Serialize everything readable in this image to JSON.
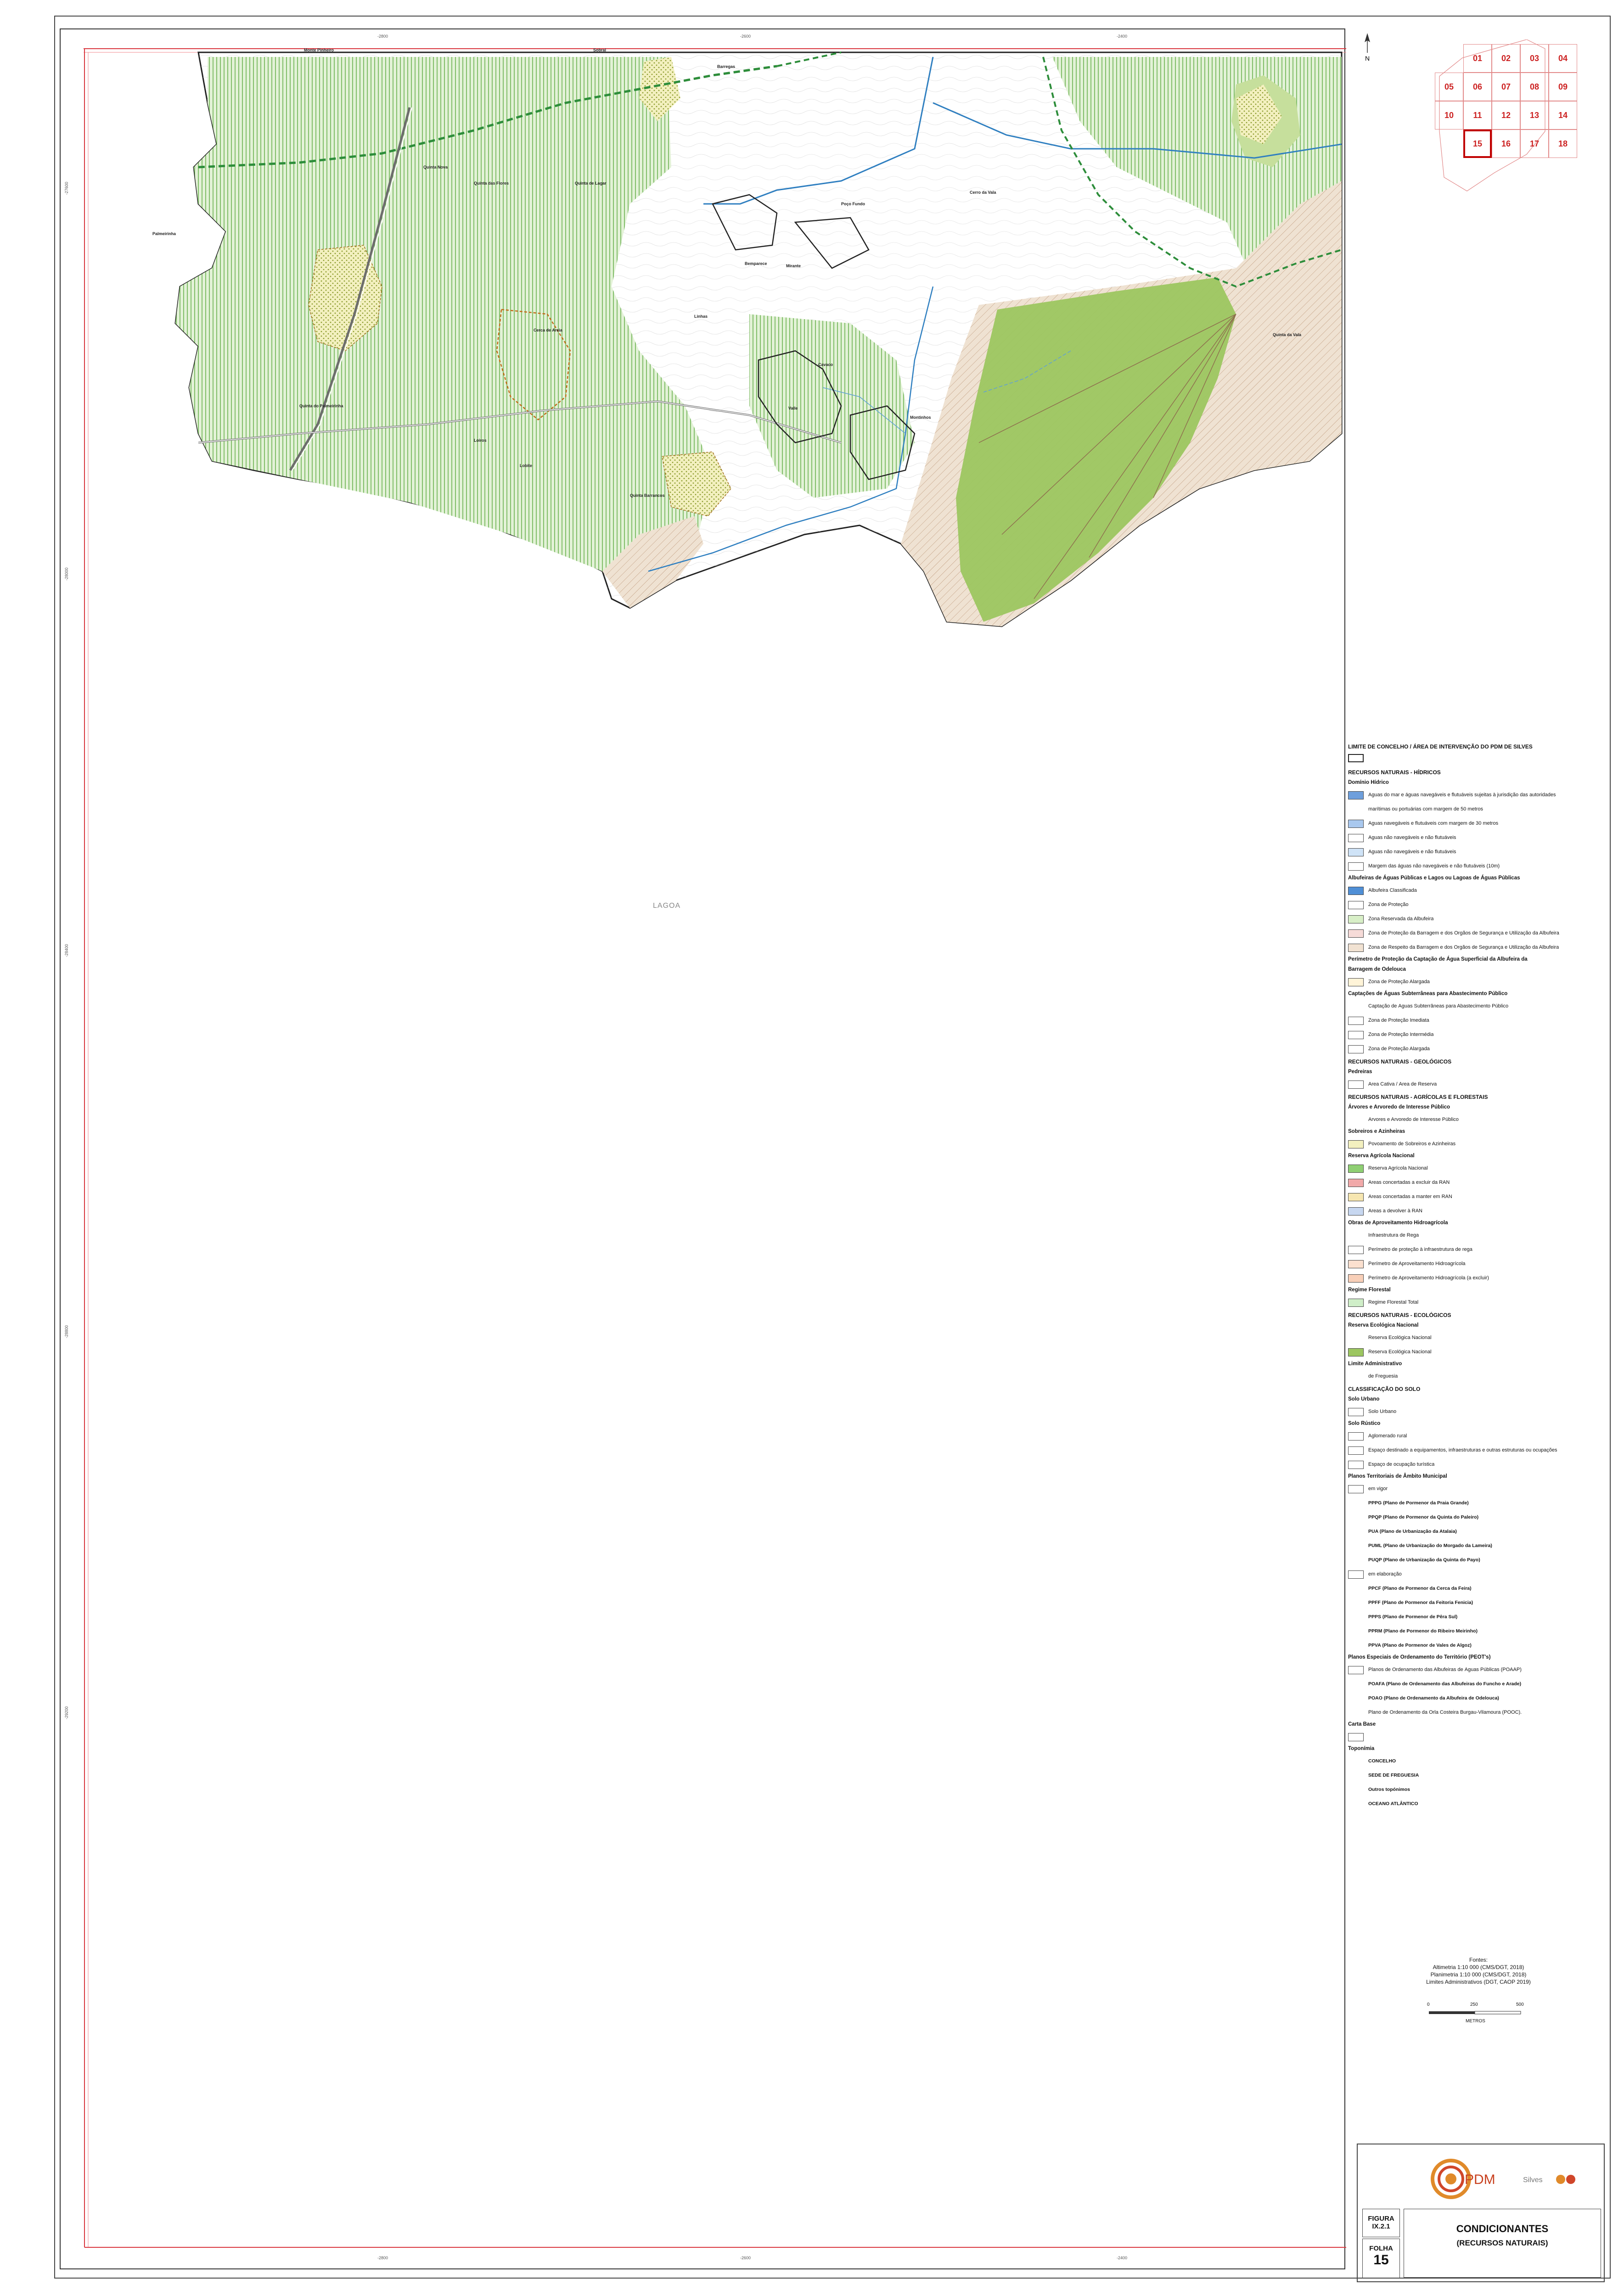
{
  "colors": {
    "ran_green": "#67b04c",
    "ren_green": "#9cc660",
    "river_blue": "#2f7fc0",
    "limit_red": "#d9363e",
    "boundary_dark": "#222222",
    "dashed_green": "#2d8d3a",
    "brown_hatch": "#9f6f55"
  },
  "map": {
    "concelho_label": "LAGOA",
    "coords_top": [
      "-2800",
      "-2600",
      "-2400"
    ],
    "coords_bottom": [
      "-2800",
      "-2600",
      "-2400"
    ],
    "coords_side": [
      "-27600",
      "-28000",
      "-28400",
      "-28800",
      "-29200"
    ],
    "toponyms": [
      {
        "text": "Monte Pinheiro"
      },
      {
        "text": "Sobral"
      },
      {
        "text": "Barregas"
      },
      {
        "text": "Quinta Nova"
      },
      {
        "text": "Quinta das Flores"
      },
      {
        "text": "Quinta de Lagar"
      },
      {
        "text": "Poço Fundo"
      },
      {
        "text": "Cerro da Vala"
      },
      {
        "text": "Palmeirinha"
      },
      {
        "text": "Bemparece"
      },
      {
        "text": "Mirante"
      },
      {
        "text": "Linhas"
      },
      {
        "text": "Cerca de Areia"
      },
      {
        "text": "Quinta do Palmeirinha"
      },
      {
        "text": "Cavaco"
      },
      {
        "text": "Valle"
      },
      {
        "text": "Montinhos"
      },
      {
        "text": "Loiros"
      },
      {
        "text": "Lobite"
      },
      {
        "text": "Quinta Barrancos"
      },
      {
        "text": "Quinta da Vala"
      }
    ]
  },
  "index_map": {
    "cells": [
      {
        "label": "01"
      },
      {
        "label": "02"
      },
      {
        "label": "03"
      },
      {
        "label": "04"
      },
      {
        "label": "05"
      },
      {
        "label": "06"
      },
      {
        "label": "07"
      },
      {
        "label": "08"
      },
      {
        "label": "09"
      },
      {
        "label": "10"
      },
      {
        "label": "11"
      },
      {
        "label": "12"
      },
      {
        "label": "13"
      },
      {
        "label": "14"
      },
      {
        "label": "15"
      },
      {
        "label": "16"
      },
      {
        "label": "17"
      },
      {
        "label": "18"
      }
    ],
    "current": "15",
    "north_label": "N"
  },
  "legend": {
    "limit_title": "LIMITE DE CONCELHO / ÁREA DE INTERVENÇÃO DO PDM DE SILVES",
    "rows": [
      {
        "kind": "h1",
        "text": "RECURSOS NATURAIS - HÍDRICOS"
      },
      {
        "kind": "h2",
        "text": "Domínio Hídrico"
      },
      {
        "kind": "item",
        "swatch": "#6e9fdc",
        "text": "Águas do mar e águas navegáveis e flutuáveis sujeitas à jurisdição das autoridades"
      },
      {
        "kind": "item",
        "swatch": "none",
        "text": "marítimas ou portuárias com margem de 50 metros"
      },
      {
        "kind": "item",
        "swatch": "#a9c8ee",
        "text": "Águas navegáveis e flutuáveis com margem de 30 metros"
      },
      {
        "kind": "item",
        "swatch": "#ffffff",
        "text": "Águas não navegáveis e não flutuáveis"
      },
      {
        "kind": "item",
        "swatch": "#cfe3f7",
        "text": "Águas não navegáveis e não flutuáveis"
      },
      {
        "kind": "item",
        "swatch": "#ffffff",
        "text": "Margem das águas não navegáveis e não flutuáveis (10m)"
      },
      {
        "kind": "h2",
        "text": "Albufeiras de Águas Públicas e Lagos ou Lagoas de Águas Públicas"
      },
      {
        "kind": "item",
        "swatch": "#4f8fd6",
        "text": "Albufeira Classificada"
      },
      {
        "kind": "item",
        "swatch": "#ffffff",
        "text": "Zona de Proteção"
      },
      {
        "kind": "item",
        "swatch": "#d8efc7",
        "text": "Zona Reservada da Albufeira"
      },
      {
        "kind": "item",
        "swatch": "#f6dbd8",
        "text": "Zona de Proteção da Barragem e dos Órgãos de Segurança e Utilização da Albufeira"
      },
      {
        "kind": "item",
        "swatch": "#f1e2d2",
        "text": "Zona de Respeito da Barragem e dos Órgãos de Segurança e Utilização da Albufeira"
      },
      {
        "kind": "h2",
        "text": "Perímetro de Proteção da Captação de Água Superficial da Albufeira da"
      },
      {
        "kind": "h2",
        "text": "Barragem de Odelouca"
      },
      {
        "kind": "item",
        "swatch": "#fff4d8",
        "text": "Zona de Proteção Alargada"
      },
      {
        "kind": "h2",
        "text": "Captações de Águas Subterrâneas para Abastecimento Público"
      },
      {
        "kind": "item",
        "swatch": "none",
        "text": "Captação de Águas Subterrâneas para Abastecimento Público"
      },
      {
        "kind": "item",
        "swatch": "#ffffff",
        "text": "Zona de Proteção Imediata"
      },
      {
        "kind": "item",
        "swatch": "#ffffff",
        "text": "Zona de Proteção Intermédia"
      },
      {
        "kind": "item",
        "swatch": "#ffffff",
        "text": "Zona de Proteção Alargada"
      },
      {
        "kind": "h1",
        "text": "RECURSOS NATURAIS - GEOLÓGICOS"
      },
      {
        "kind": "h2",
        "text": "Pedreiras"
      },
      {
        "kind": "item",
        "swatch": "#ffffff",
        "text": "Área Cativa / Área de Reserva"
      },
      {
        "kind": "h1",
        "text": "RECURSOS NATURAIS - AGRÍCOLAS E FLORESTAIS"
      },
      {
        "kind": "h2",
        "text": "Árvores e Arvoredo de Interesse Público"
      },
      {
        "kind": "item",
        "swatch": "none",
        "text": "Árvores e Arvoredo de Interesse Público"
      },
      {
        "kind": "h2",
        "text": "Sobreiros e Azinheiras"
      },
      {
        "kind": "item",
        "swatch": "#f3f0bf",
        "text": "Povoamento de Sobreiros e Azinheiras"
      },
      {
        "kind": "h2",
        "text": "Reserva Agrícola Nacional"
      },
      {
        "kind": "item",
        "swatch": "#8fcf73",
        "text": "Reserva Agrícola Nacional"
      },
      {
        "kind": "item",
        "swatch": "#f1a9a9",
        "text": "Áreas concertadas a excluir da RAN"
      },
      {
        "kind": "item",
        "swatch": "#f6e6b0",
        "text": "Áreas concertadas a manter em RAN"
      },
      {
        "kind": "item",
        "swatch": "#c7d7f0",
        "text": "Áreas a devolver à RAN"
      },
      {
        "kind": "h2",
        "text": "Obras de Aproveitamento Hidroagrícola"
      },
      {
        "kind": "item",
        "swatch": "none",
        "text": "Infraestrutura de Rega"
      },
      {
        "kind": "item",
        "swatch": "#ffffff",
        "text": "Perímetro de proteção à infraestrutura de rega"
      },
      {
        "kind": "item",
        "swatch": "#fbe0cf",
        "text": "Perímetro de Aproveitamento Hidroagrícola"
      },
      {
        "kind": "item",
        "swatch": "#f8cfb8",
        "text": "Perímetro de Aproveitamento Hidroagrícola (a excluir)"
      },
      {
        "kind": "h2",
        "text": "Regime Florestal"
      },
      {
        "kind": "item",
        "swatch": "#cfeec8",
        "text": "Regime Florestal Total"
      },
      {
        "kind": "h1",
        "text": "RECURSOS NATURAIS - ECOLÓGICOS"
      },
      {
        "kind": "h2",
        "text": "Reserva Ecológica Nacional"
      },
      {
        "kind": "item",
        "swatch": "none",
        "text": "Reserva Ecológica Nacional"
      },
      {
        "kind": "item",
        "swatch": "#9cc660",
        "text": "Reserva Ecológica Nacional"
      },
      {
        "kind": "h2",
        "text": "Limite Administrativo"
      },
      {
        "kind": "item",
        "swatch": "none",
        "text": "de Freguesia"
      },
      {
        "kind": "h1",
        "text": "CLASSIFICAÇÃO DO SOLO"
      },
      {
        "kind": "h2",
        "text": "Solo Urbano"
      },
      {
        "kind": "item",
        "swatch": "#ffffff",
        "text": "Solo Urbano"
      },
      {
        "kind": "h2",
        "text": "Solo Rústico"
      },
      {
        "kind": "item",
        "swatch": "#ffffff",
        "text": "Aglomerado rural"
      },
      {
        "kind": "item",
        "swatch": "#ffffff",
        "text": "Espaço destinado a equipamentos, infraestruturas e outras estruturas ou ocupações"
      },
      {
        "kind": "item",
        "swatch": "#ffffff",
        "text": "Espaço de ocupação turística"
      },
      {
        "kind": "h2",
        "text": "Planos Territoriais de Âmbito Municipal"
      },
      {
        "kind": "item",
        "swatch": "#ffffff",
        "text": "em vigor"
      },
      {
        "kind": "sub",
        "text": "PPPG (Plano de Pormenor da Praia Grande)"
      },
      {
        "kind": "sub",
        "text": "PPQP (Plano de Pormenor da Quinta do Paleiro)"
      },
      {
        "kind": "sub",
        "text": "PUA (Plano de Urbanização da Atalaia)"
      },
      {
        "kind": "sub",
        "text": "PUML (Plano de Urbanização do Morgado da Lameira)"
      },
      {
        "kind": "sub",
        "text": "PUQP (Plano de Urbanização da Quinta do Payo)"
      },
      {
        "kind": "item",
        "swatch": "#ffffff",
        "text": "em elaboração"
      },
      {
        "kind": "sub",
        "text": "PPCF (Plano de Pormenor da Cerca da Feira)"
      },
      {
        "kind": "sub",
        "text": "PPFF (Plano de Pormenor da Feitoria Fenicia)"
      },
      {
        "kind": "sub",
        "text": "PPPS (Plano de Pormenor de Pêra Sul)"
      },
      {
        "kind": "sub",
        "text": "PPRM (Plano de Pormenor do Ribeiro Meirinho)"
      },
      {
        "kind": "sub",
        "text": "PPVA (Plano de Pormenor de Vales de Algoz)"
      },
      {
        "kind": "h2",
        "text": "Planos Especiais de Ordenamento do Território (PEOT's)"
      },
      {
        "kind": "item",
        "swatch": "#ffffff",
        "text": "Planos de Ordenamento das Albufeiras de Águas Públicas (POAAP)"
      },
      {
        "kind": "sub",
        "text": "POAFA (Plano de Ordenamento das Albufeiras do Funcho e Arade)"
      },
      {
        "kind": "sub",
        "text": "POAO (Plano de Ordenamento da Albufeira de Odelouca)"
      },
      {
        "kind": "item",
        "swatch": "none",
        "text": "Plano de Ordenamento da Orla Costeira Burgau-Vilamoura (POOC)."
      },
      {
        "kind": "h2",
        "text": "Carta Base"
      },
      {
        "kind": "item",
        "swatch": "#ffffff",
        "text": ""
      },
      {
        "kind": "h2",
        "text": "Toponímia"
      },
      {
        "kind": "sub",
        "text": "CONCELHO"
      },
      {
        "kind": "sub",
        "text": "SEDE DE FREGUESIA"
      },
      {
        "kind": "sub",
        "text": "Outros topónimos"
      },
      {
        "kind": "sub",
        "text": "OCEANO ATLÂNTICO"
      }
    ]
  },
  "sources": {
    "heading": "Fontes:",
    "lines": [
      "Altimetria 1:10 000 (CMS/DGT, 2018)",
      "Planimetria 1:10 000 (CMS/DGT, 2018)",
      "Limites Administrativos (DGT, CAOP 2019)"
    ]
  },
  "scale": {
    "ticks": [
      "0",
      "250",
      "500"
    ],
    "unit": "METROS"
  },
  "title_block": {
    "pdm_logo": "PDM",
    "silves_logo": "Silves",
    "figura_label": "FIGURA",
    "figura_value": "IX.2.1",
    "folha_label": "FOLHA",
    "folha_value": "15",
    "title_line1": "CONDICIONANTES",
    "title_line2": "(RECURSOS NATURAIS)"
  }
}
